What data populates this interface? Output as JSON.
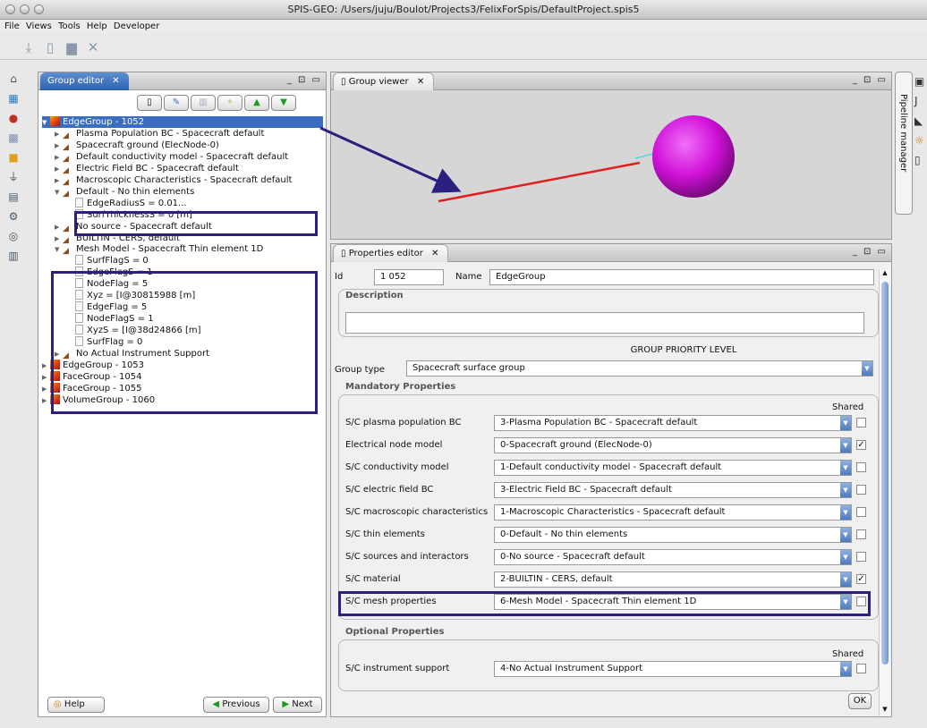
{
  "window": {
    "title": "SPIS-GEO: /Users/juju/Boulot/Projects3/FelixForSpis/DefaultProject.spis5"
  },
  "menu": [
    "File",
    "Views",
    "Tools",
    "Help",
    "Developer"
  ],
  "group_editor": {
    "tab": "Group editor",
    "tree": [
      {
        "label": "EdgeGroup - 1052",
        "kind": "group",
        "level": 0,
        "expanded": true,
        "selected": true
      },
      {
        "label": "Plasma Population BC - Spacecraft default",
        "kind": "model",
        "level": 1
      },
      {
        "label": "Spacecraft ground (ElecNode-0)",
        "kind": "model",
        "level": 1
      },
      {
        "label": "Default conductivity model - Spacecraft default",
        "kind": "model",
        "level": 1
      },
      {
        "label": "Electric Field BC - Spacecraft default",
        "kind": "model",
        "level": 1
      },
      {
        "label": "Macroscopic Characteristics - Spacecraft default",
        "kind": "model",
        "level": 1
      },
      {
        "label": "Default - No thin elements",
        "kind": "model",
        "level": 1,
        "expanded": true
      },
      {
        "label": "EdgeRadiusS = 0.01...",
        "kind": "field",
        "level": 2
      },
      {
        "label": "SurfThicknessS = 0 [m]",
        "kind": "field",
        "level": 2
      },
      {
        "label": "No source - Spacecraft default",
        "kind": "model",
        "level": 1
      },
      {
        "label": "BUILTIN - CERS, default",
        "kind": "model",
        "level": 1
      },
      {
        "label": "Mesh Model - Spacecraft Thin element 1D",
        "kind": "model",
        "level": 1,
        "expanded": true
      },
      {
        "label": "SurfFlagS = 0",
        "kind": "field",
        "level": 2
      },
      {
        "label": "EdgeFlagS = 1",
        "kind": "field",
        "level": 2
      },
      {
        "label": "NodeFlag = 5",
        "kind": "field",
        "level": 2
      },
      {
        "label": "Xyz = [I@30815988 [m]",
        "kind": "field",
        "level": 2
      },
      {
        "label": "EdgeFlag = 5",
        "kind": "field",
        "level": 2
      },
      {
        "label": "NodeFlagS = 1",
        "kind": "field",
        "level": 2
      },
      {
        "label": "XyzS = [I@38d24866 [m]",
        "kind": "field",
        "level": 2
      },
      {
        "label": "SurfFlag = 0",
        "kind": "field",
        "level": 2
      },
      {
        "label": "No Actual Instrument Support",
        "kind": "model",
        "level": 1
      },
      {
        "label": "EdgeGroup - 1053",
        "kind": "group",
        "level": 0
      },
      {
        "label": "FaceGroup - 1054",
        "kind": "group",
        "level": 0
      },
      {
        "label": "FaceGroup - 1055",
        "kind": "group",
        "level": 0
      },
      {
        "label": "VolumeGroup - 1060",
        "kind": "group",
        "level": 0
      }
    ],
    "help": "Help",
    "previous": "Previous",
    "next": "Next"
  },
  "group_viewer": {
    "tab": "Group viewer"
  },
  "pipeline": {
    "label": "Pipeline manager"
  },
  "properties": {
    "tab": "Properties editor",
    "id_label": "Id",
    "id_value": "1 052",
    "name_label": "Name",
    "name_value": "EdgeGroup",
    "description_label": "Description",
    "description_value": "",
    "priority_label": "GROUP PRIORITY LEVEL",
    "group_type_label": "Group type",
    "group_type_value": "Spacecraft surface group",
    "mandatory_label": "Mandatory Properties",
    "shared_label": "Shared",
    "rows": [
      {
        "label": "S/C plasma population BC",
        "value": "3-Plasma Population BC - Spacecraft default",
        "shared": false
      },
      {
        "label": "Electrical node model",
        "value": "0-Spacecraft ground (ElecNode-0)",
        "shared": true
      },
      {
        "label": "S/C conductivity model",
        "value": "1-Default conductivity model - Spacecraft default",
        "shared": false
      },
      {
        "label": "S/C electric field BC",
        "value": "3-Electric Field BC - Spacecraft default",
        "shared": false
      },
      {
        "label": "S/C macroscopic characteristics",
        "value": "1-Macroscopic Characteristics - Spacecraft default",
        "shared": false
      },
      {
        "label": "S/C thin elements",
        "value": "0-Default - No thin elements",
        "shared": false
      },
      {
        "label": "S/C sources and interactors",
        "value": "0-No source - Spacecraft default",
        "shared": false
      },
      {
        "label": "S/C material",
        "value": "2-BUILTIN - CERS, default",
        "shared": true
      },
      {
        "label": "S/C mesh properties",
        "value": "6-Mesh Model - Spacecraft Thin element 1D",
        "shared": false
      }
    ],
    "optional_label": "Optional Properties",
    "optional_rows": [
      {
        "label": "S/C instrument support",
        "value": "4-No Actual Instrument Support",
        "shared": false
      }
    ],
    "ok": "OK"
  }
}
